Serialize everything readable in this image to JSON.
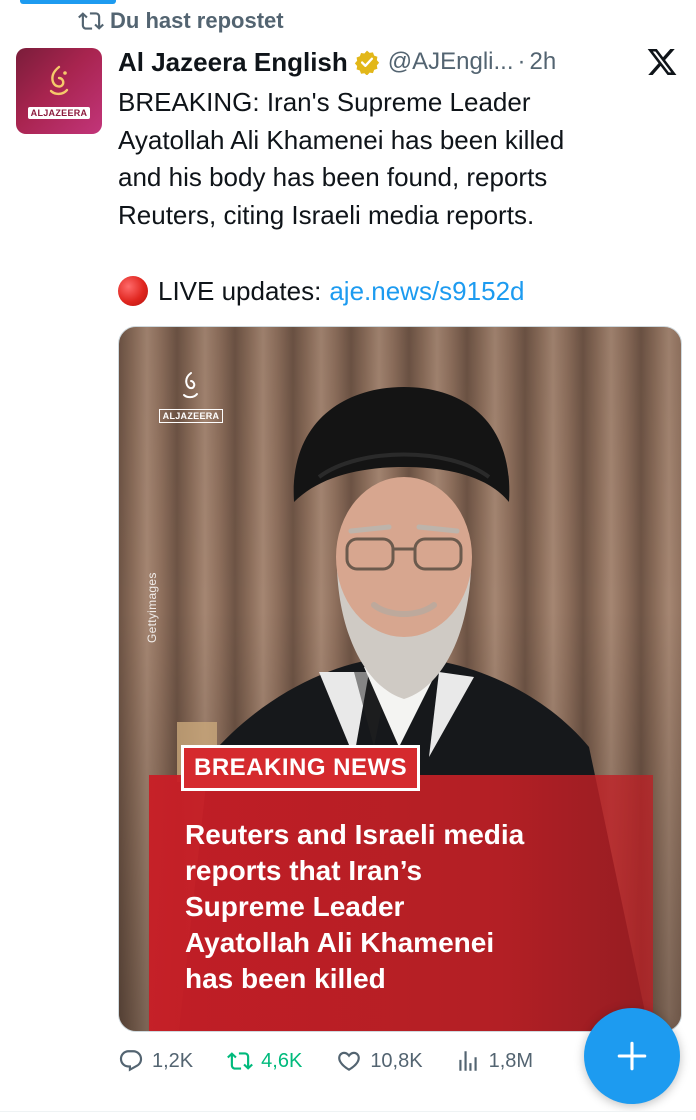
{
  "repost_banner": {
    "icon": "repost-icon",
    "label": "Du hast repostet"
  },
  "tweet": {
    "avatar_label": "ALJAZEERA",
    "author": "Al Jazeera English",
    "verified_icon": "verified-badge-icon",
    "handle": "@AJEngli...",
    "separator": "·",
    "time": "2h",
    "platform_icon": "x-logo-icon",
    "text_lines": [
      "BREAKING: Iran's Supreme Leader",
      "Ayatollah Ali Khamenei has been killed",
      "and his body has been found, reports",
      "Reuters, citing Israeli media reports."
    ],
    "live_label": "LIVE updates:",
    "live_link": "aje.news/s9152d",
    "media": {
      "watermark_label": "ALJAZEERA",
      "getty_credit": "Gettyimages",
      "badge": "BREAKING NEWS",
      "caption_lines": [
        "Reuters and Israeli media",
        "reports that Iran’s",
        "Supreme Leader",
        "Ayatollah Ali Khamenei",
        "has been killed"
      ]
    },
    "actions": {
      "replies": "1,2K",
      "reposts": "4,6K",
      "likes": "10,8K",
      "views": "1,8M"
    }
  },
  "fab": {
    "icon": "plus-icon"
  },
  "colors": {
    "accent": "#1d9bf0",
    "repost_green": "#00ba7c",
    "muted": "#536471",
    "breaking_red": "#d52a2e"
  }
}
